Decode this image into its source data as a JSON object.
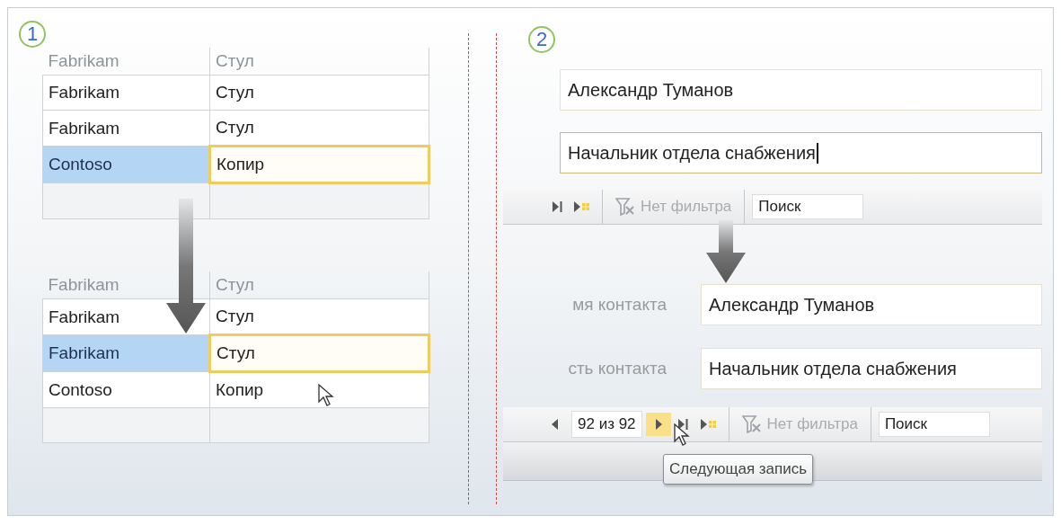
{
  "panel_1": {
    "number": "1",
    "tables": [
      {
        "header": [
          "Fabrikam",
          "Стул"
        ],
        "rows": [
          {
            "cells": [
              "Fabrikam",
              "Стул"
            ],
            "selected": false
          },
          {
            "cells": [
              "Fabrikam",
              "Стул"
            ],
            "selected": false
          },
          {
            "cells": [
              "Contoso",
              "Копир"
            ],
            "selected": true
          }
        ]
      },
      {
        "header": [
          "Fabrikam",
          "Стул"
        ],
        "rows": [
          {
            "cells": [
              "Fabrikam",
              "Стул"
            ],
            "selected": false
          },
          {
            "cells": [
              "Fabrikam",
              "Стул"
            ],
            "selected": true
          },
          {
            "cells": [
              "Contoso",
              "Копир"
            ],
            "selected": false
          }
        ]
      }
    ]
  },
  "panel_2": {
    "number": "2",
    "forms": [
      {
        "fields": [
          {
            "value": "Александр Туманов",
            "focused": false
          },
          {
            "value": "Начальник отдела снабжения",
            "focused": true
          }
        ],
        "toolbar": {
          "nav_buttons": [
            {
              "kind": "last",
              "hovered": false
            },
            {
              "kind": "new",
              "hovered": false
            }
          ],
          "filter": "Нет фильтра",
          "search": "Поиск"
        }
      },
      {
        "fields": [
          {
            "label": "мя контакта",
            "value": "Александр Туманов",
            "focused": false
          },
          {
            "label": "сть контакта",
            "value": "Начальник отдела снабжения",
            "focused": false
          }
        ],
        "toolbar": {
          "nav_buttons": [
            {
              "kind": "prev",
              "hovered": false
            },
            {
              "kind": "record",
              "text": "92 из 92"
            },
            {
              "kind": "next",
              "hovered": true
            },
            {
              "kind": "last",
              "hovered": false
            },
            {
              "kind": "new",
              "hovered": false
            }
          ],
          "filter": "Нет фильтра",
          "search": "Поиск"
        },
        "tooltip": "Следующая запись"
      }
    ]
  }
}
